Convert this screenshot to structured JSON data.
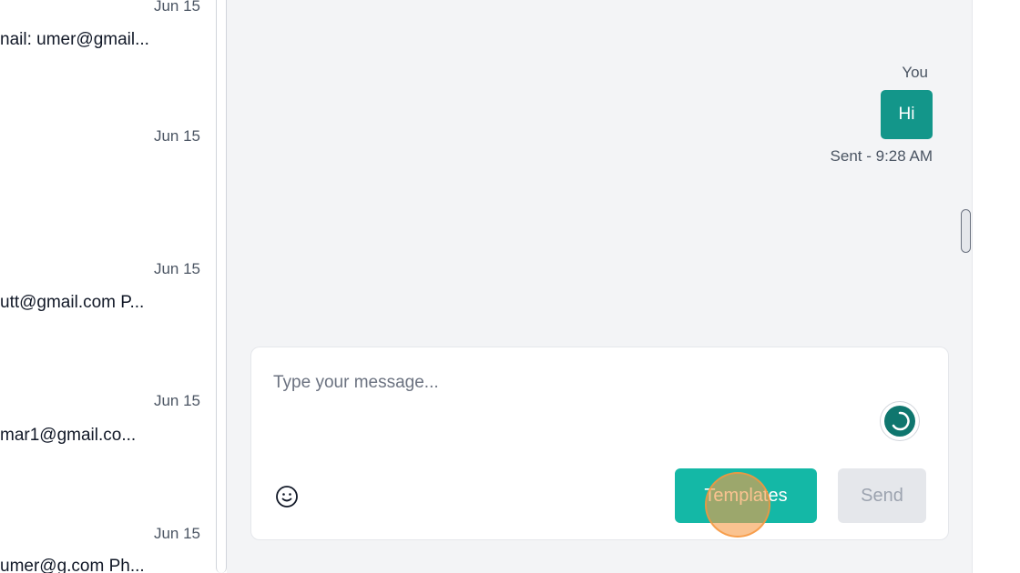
{
  "conversations": [
    {
      "date": "Jun 15",
      "preview": "nail: umer@gmail..."
    },
    {
      "date": "Jun 15",
      "preview": ""
    },
    {
      "date": "Jun 15",
      "preview": "utt@gmail.com P..."
    },
    {
      "date": "Jun 15",
      "preview": "mar1@gmail.co..."
    },
    {
      "date": "Jun 15",
      "preview": "umer@g.com Ph..."
    }
  ],
  "chat": {
    "sender": "You",
    "message": "Hi",
    "status": "Sent  - 9:28 AM"
  },
  "composer": {
    "placeholder": "Type your message...",
    "templates_label": "Templates",
    "send_label": "Send"
  },
  "icons": {
    "emoji": "smiley-face-icon",
    "assistant": "loading-spinner-icon"
  },
  "colors": {
    "accent": "#14b8a6",
    "bubble": "#13968a",
    "spinner": "#0f766e"
  }
}
